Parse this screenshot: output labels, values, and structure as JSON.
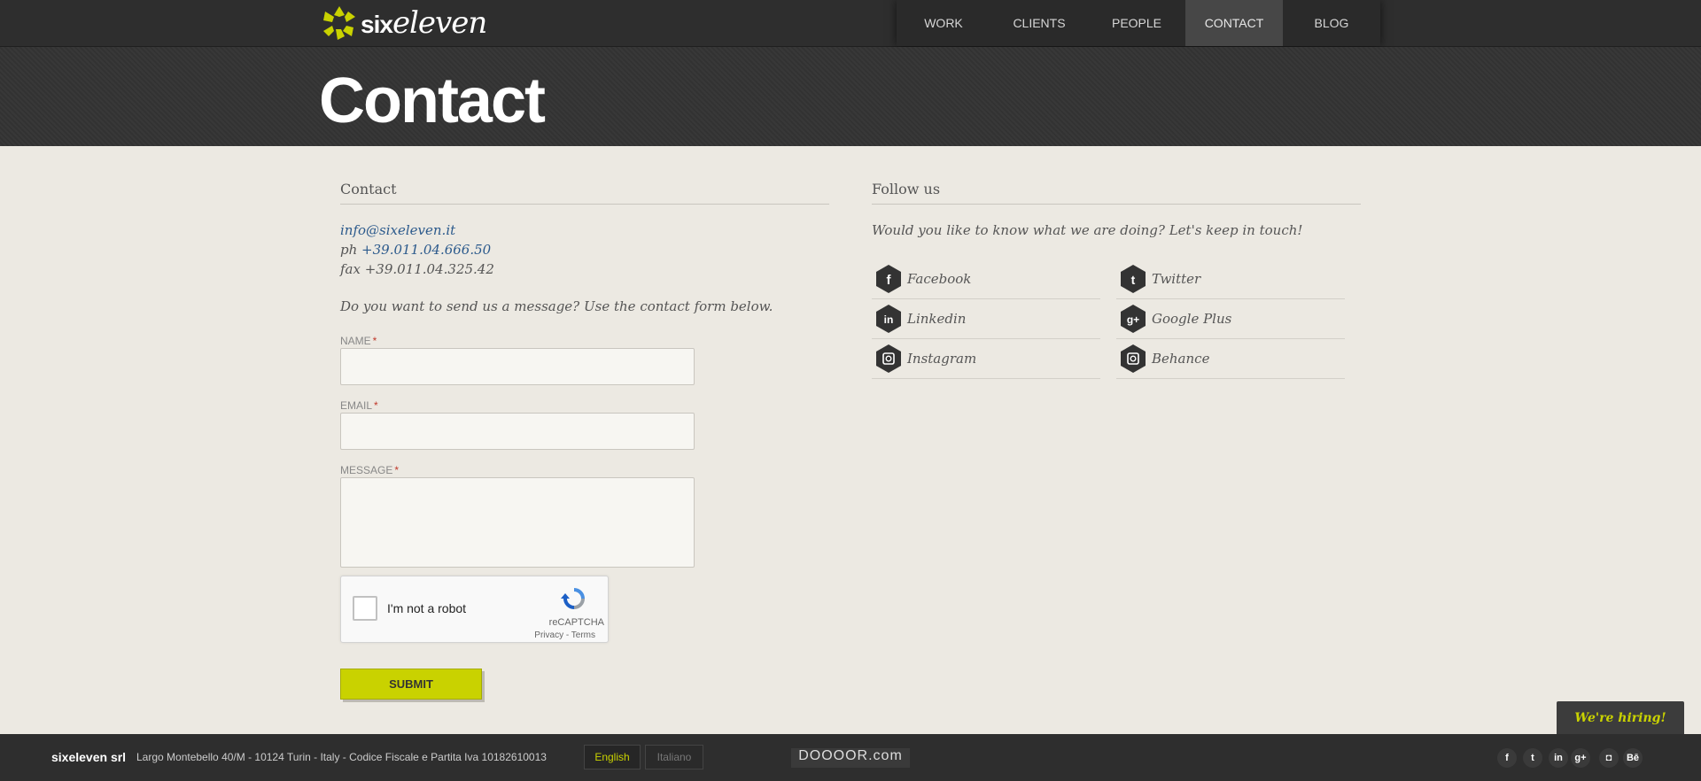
{
  "brand": {
    "logo_bold": "six",
    "logo_italic": "eleven"
  },
  "nav": [
    {
      "label": "WORK"
    },
    {
      "label": "CLIENTS"
    },
    {
      "label": "PEOPLE"
    },
    {
      "label": "CONTACT",
      "active": true
    },
    {
      "label": "BLOG"
    }
  ],
  "hero": {
    "title": "Contact"
  },
  "contact": {
    "heading": "Contact",
    "email": "info@sixeleven.it",
    "phone_prefix": "ph",
    "phone": "+39.011.04.666.50",
    "fax": "fax +39.011.04.325.42",
    "intro": "Do you want to send us a message? Use the contact form below.",
    "form": {
      "name_label": "NAME",
      "email_label": "EMAIL",
      "message_label": "MESSAGE",
      "required_mark": "*",
      "name_value": "",
      "email_value": "",
      "message_value": "",
      "captcha_label": "I'm not a robot",
      "captcha_brand": "reCAPTCHA",
      "captcha_links": "Privacy - Terms",
      "submit_label": "SUBMIT"
    }
  },
  "follow": {
    "heading": "Follow us",
    "intro": "Would you like to know what we are doing? Let's keep in touch!",
    "networks": [
      {
        "label": "Facebook",
        "icon": "facebook-icon"
      },
      {
        "label": "Twitter",
        "icon": "twitter-icon"
      },
      {
        "label": "Linkedin",
        "icon": "linkedin-icon"
      },
      {
        "label": "Google Plus",
        "icon": "google-plus-icon"
      },
      {
        "label": "Instagram",
        "icon": "instagram-icon"
      },
      {
        "label": "Behance",
        "icon": "behance-icon"
      }
    ]
  },
  "footer": {
    "company": "sixeleven srl",
    "address": "Largo Montebello 40/M - 10124 Turin - Italy - Codice Fiscale e Partita Iva 10182610013",
    "lang_english": "English",
    "lang_italiano": "Italiano",
    "watermark": "DOOOOR.com",
    "social_glyphs": [
      "f",
      "t",
      "in",
      "g+",
      "◘",
      "Bē"
    ]
  },
  "hiring": "We're hiring!",
  "colors": {
    "accent": "#c9d200",
    "dark": "#2e2e2e",
    "page_bg": "#ece9e2",
    "link": "#2c5a8c"
  }
}
